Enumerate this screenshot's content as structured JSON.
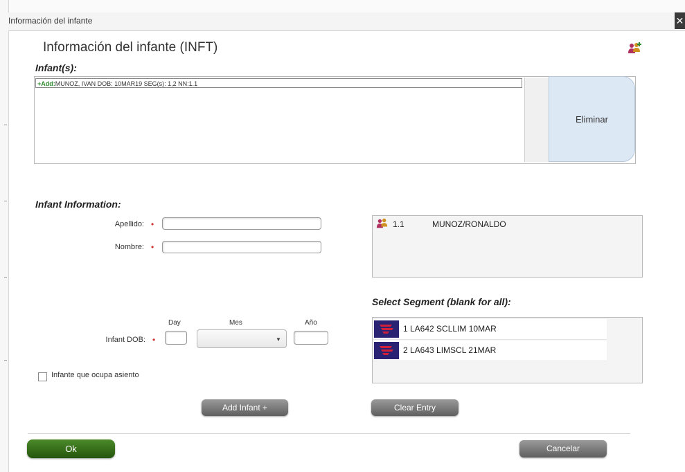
{
  "window": {
    "title": "Información del infante",
    "close_label": "✕"
  },
  "dialog": {
    "title": "Información del infante (INFT)",
    "icon": "passenger-group-icon"
  },
  "infants_section": {
    "label": "Infant(s):",
    "rows": [
      {
        "prefix": "+Add:",
        "text": "MUNOZ, IVAN DOB: 10MAR19 SEG(s): 1,2 NN:1.1"
      }
    ],
    "eliminar_label": "Eliminar"
  },
  "infant_info": {
    "label": "Infant Information:",
    "apellido_label": "Apellido:",
    "apellido_value": "",
    "nombre_label": "Nombre:",
    "nombre_value": "",
    "required_mark": "•",
    "dob_label": "Infant DOB:",
    "day_label": "Day",
    "mes_label": "Mes",
    "ano_label": "Año",
    "day_value": "",
    "mes_value": "",
    "ano_value": "",
    "seat_checkbox_label": "Infante que ocupa asiento",
    "seat_checked": false
  },
  "passengers": [
    {
      "num": "1.1",
      "name": "MUNOZ/RONALDO",
      "icon": "passenger-icon"
    }
  ],
  "segments_section": {
    "label": "Select Segment (blank for all):",
    "segments": [
      {
        "text": "1 LA642 SCLLIM 10MAR",
        "icon": "airline-logo-icon"
      },
      {
        "text": "2 LA643 LIMSCL 21MAR",
        "icon": "airline-logo-icon"
      }
    ]
  },
  "buttons": {
    "add_infant": "Add Infant +",
    "clear_entry": "Clear Entry",
    "ok": "Ok",
    "cancelar": "Cancelar"
  },
  "colors": {
    "ok_button": "#3a7020",
    "gray_button": "#7a7a7a",
    "eliminar_bg": "#dde8f5",
    "airline_logo": "#2a2273",
    "airline_accent": "#d0203a",
    "required": "#d03030",
    "add_prefix": "#2f8a2f"
  }
}
